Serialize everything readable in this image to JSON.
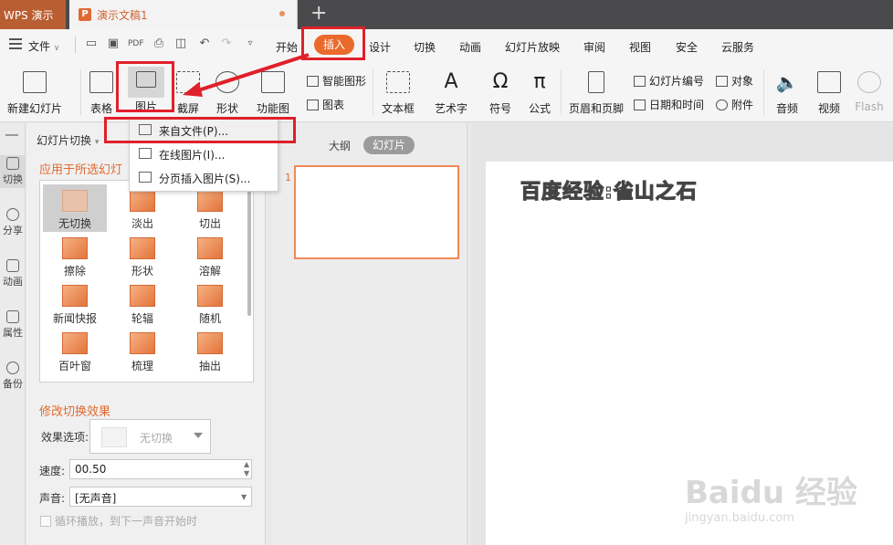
{
  "titlebar": {
    "app_name": "WPS 演示",
    "doc_name": "演示文稿1",
    "new_tab": "+"
  },
  "menubar": {
    "file": "文件",
    "items": [
      "开始",
      "插入",
      "设计",
      "切换",
      "动画",
      "幻灯片放映",
      "审阅",
      "视图",
      "安全",
      "云服务"
    ]
  },
  "ribbon": {
    "new_slide": "新建幻灯片",
    "table": "表格",
    "picture": "图片",
    "screenshot": "截屏",
    "shape": "形状",
    "function_chart": "功能图",
    "smart_art": "智能图形",
    "chart": "图表",
    "textbox": "文本框",
    "wordart": "艺术字",
    "symbol": "符号",
    "formula": "公式",
    "header_footer": "页眉和页脚",
    "slide_number": "幻灯片编号",
    "object": "对象",
    "datetime": "日期和时间",
    "attachment": "附件",
    "audio": "音频",
    "video": "视频",
    "flash": "Flash"
  },
  "picture_menu": {
    "from_file": "来自文件(P)...",
    "online": "在线图片(I)...",
    "paged": "分页插入图片(S)..."
  },
  "side": {
    "items": [
      "切换",
      "分享",
      "动画",
      "属性",
      "备份"
    ]
  },
  "panel": {
    "title": "幻灯片切换",
    "apply_title": "应用于所选幻灯",
    "transitions": [
      "无切换",
      "淡出",
      "切出",
      "擦除",
      "形状",
      "溶解",
      "新闻快报",
      "轮辐",
      "随机",
      "百叶窗",
      "梳理",
      "抽出"
    ],
    "modify_title": "修改切换效果",
    "effect_label": "效果选项:",
    "effect_value": "无切换",
    "speed_label": "速度:",
    "speed_value": "00.50",
    "sound_label": "声音:",
    "sound_value": "[无声音]",
    "loop_label": "循环播放，到下一声音开始时"
  },
  "slides": {
    "tab_outline": "大纲",
    "tab_slides": "幻灯片",
    "thumb_number": "1"
  },
  "slide": {
    "text": "百度经验:雀山之石"
  },
  "watermark": {
    "main": "Baidu 经验",
    "sub": "jingyan.baidu.com"
  },
  "colors": {
    "accent": "#ea6a2b",
    "highlight": "#e0202a"
  }
}
